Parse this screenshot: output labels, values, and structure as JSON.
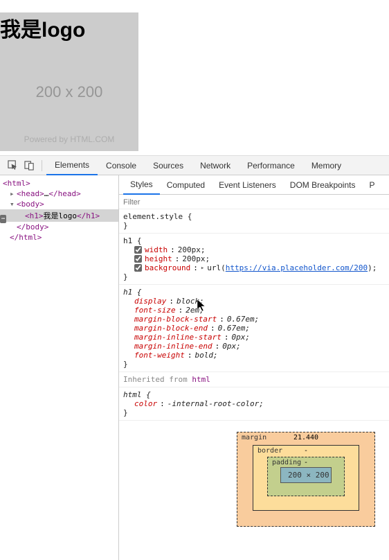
{
  "page": {
    "heading": "我是logo",
    "placeholder_dim": "200 x 200",
    "powered": "Powered by HTML.COM"
  },
  "devtools": {
    "tabs": [
      "Elements",
      "Console",
      "Sources",
      "Network",
      "Performance",
      "Memory"
    ],
    "active_tab": "Elements",
    "sub_tabs": [
      "Styles",
      "Computed",
      "Event Listeners",
      "DOM Breakpoints",
      "P"
    ],
    "active_sub_tab": "Styles",
    "filter_placeholder": "Filter"
  },
  "dom": {
    "l0": "<html>",
    "l1_open": "<head>",
    "l1_ellipsis": "…",
    "l1_close": "</head>",
    "l2_open": "<body>",
    "l3_open": "<h1>",
    "l3_text": "我是logo",
    "l3_close": "</h1>",
    "l2_close": "</body>",
    "l0_close": "</html>"
  },
  "styles": {
    "element_style": "element.style {",
    "h1_sel": "h1 {",
    "width": {
      "name": "width",
      "val": "200px;"
    },
    "height": {
      "name": "height",
      "val": "200px;"
    },
    "background": {
      "name": "background",
      "val_prefix": "url(",
      "url": "https://via.placeholder.com/200",
      "val_suffix": ");"
    },
    "ua_h1": "h1 {",
    "ua_props": {
      "display": {
        "n": "display",
        "v": "block;"
      },
      "font_size": {
        "n": "font-size",
        "v": "2em;"
      },
      "mbs": {
        "n": "margin-block-start",
        "v": "0.67em;"
      },
      "mbe": {
        "n": "margin-block-end",
        "v": "0.67em;"
      },
      "mis": {
        "n": "margin-inline-start",
        "v": "0px;"
      },
      "mie": {
        "n": "margin-inline-end",
        "v": "0px;"
      },
      "fw": {
        "n": "font-weight",
        "v": "bold;"
      }
    },
    "inherited_label": "Inherited from ",
    "inherited_tag": "html",
    "html_sel": "html {",
    "html_color": {
      "n": "color",
      "v": "-internal-root-color;"
    },
    "close_brace": "}"
  },
  "box_model": {
    "margin_label": "margin",
    "margin_top": "21.440",
    "border_label": "border",
    "border_top": "-",
    "padding_label": "padding",
    "padding_top": "-",
    "content": "200 × 200"
  }
}
